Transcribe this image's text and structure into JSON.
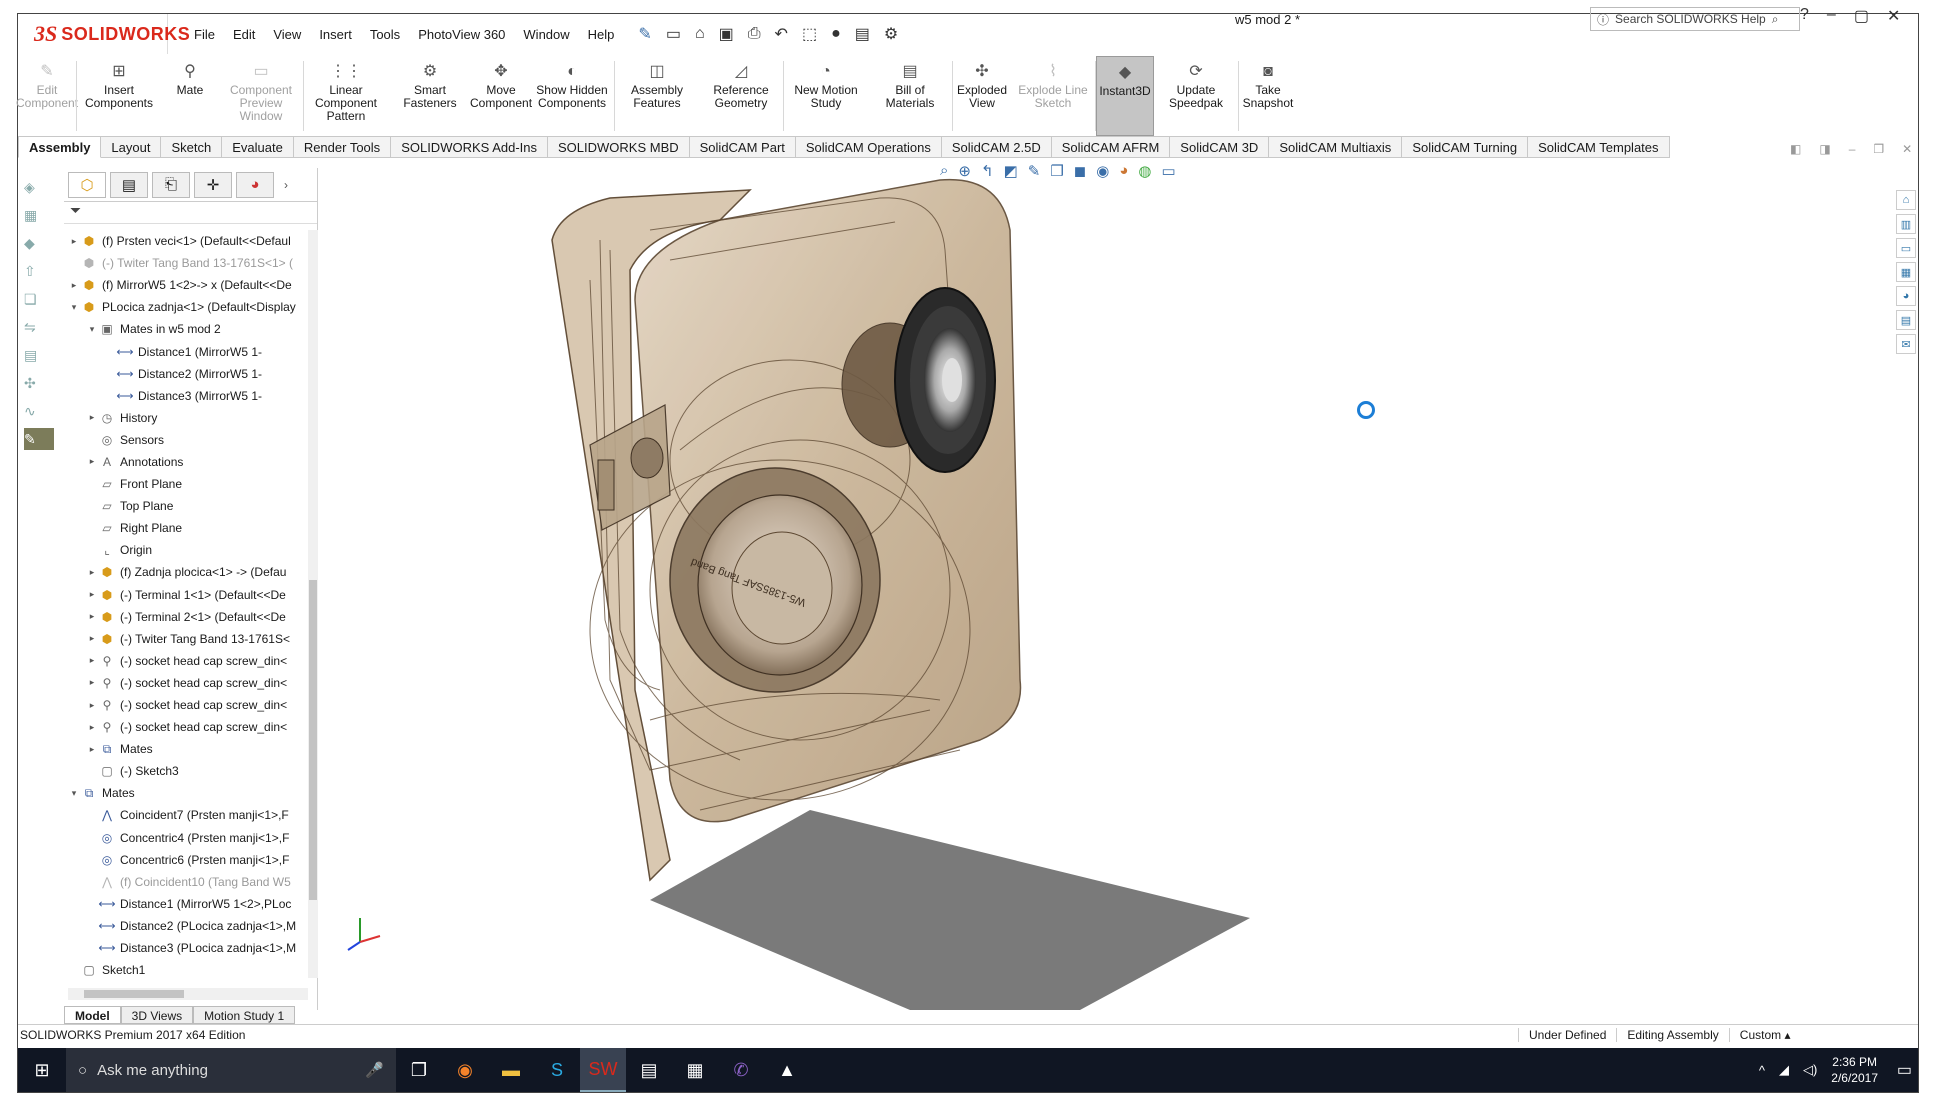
{
  "app": {
    "brand_mark": "3S",
    "brand_name": "SOLIDWORKS",
    "doc_title": "w5 mod 2 *"
  },
  "menu": [
    "File",
    "Edit",
    "View",
    "Insert",
    "Tools",
    "PhotoView 360",
    "Window",
    "Help"
  ],
  "search": {
    "placeholder": "Search SOLIDWORKS Help"
  },
  "commands": [
    {
      "label": "Edit Component",
      "icon": "edit-component-icon",
      "disabled": true
    },
    {
      "label": "Insert Components",
      "icon": "insert-components-icon",
      "disabled": false
    },
    {
      "label": "Mate",
      "icon": "mate-icon",
      "disabled": false
    },
    {
      "label": "Component Preview Window",
      "icon": "preview-window-icon",
      "disabled": true
    },
    {
      "label": "Linear Component Pattern",
      "icon": "linear-pattern-icon",
      "disabled": false
    },
    {
      "label": "Smart Fasteners",
      "icon": "smart-fasteners-icon",
      "disabled": false
    },
    {
      "label": "Move Component",
      "icon": "move-component-icon",
      "disabled": false
    },
    {
      "label": "Show Hidden Components",
      "icon": "show-hidden-icon",
      "disabled": false
    },
    {
      "label": "Assembly Features",
      "icon": "assembly-features-icon",
      "disabled": false
    },
    {
      "label": "Reference Geometry",
      "icon": "reference-geometry-icon",
      "disabled": false
    },
    {
      "label": "New Motion Study",
      "icon": "motion-study-icon",
      "disabled": false
    },
    {
      "label": "Bill of Materials",
      "icon": "bom-icon",
      "disabled": false
    },
    {
      "label": "Exploded View",
      "icon": "exploded-view-icon",
      "disabled": false
    },
    {
      "label": "Explode Line Sketch",
      "icon": "explode-line-icon",
      "disabled": true
    },
    {
      "label": "Instant3D",
      "icon": "instant3d-icon",
      "disabled": false,
      "active": true
    },
    {
      "label": "Update Speedpak",
      "icon": "speedpak-icon",
      "disabled": false
    },
    {
      "label": "Take Snapshot",
      "icon": "camera-icon",
      "disabled": false
    }
  ],
  "tabs": [
    "Assembly",
    "Layout",
    "Sketch",
    "Evaluate",
    "Render Tools",
    "SOLIDWORKS Add-Ins",
    "SOLIDWORKS MBD",
    "SolidCAM Part",
    "SolidCAM Operations",
    "SolidCAM 2.5D",
    "SolidCAM AFRM",
    "SolidCAM 3D",
    "SolidCAM Multiaxis",
    "SolidCAM Turning",
    "SolidCAM Templates"
  ],
  "tree": [
    {
      "label": "(f) Prsten veci<1> (Default<<Defaul",
      "level": 0,
      "exp": "▸",
      "icon": "part"
    },
    {
      "label": "(-) Twiter Tang Band 13-1761S<1> (",
      "level": 0,
      "exp": "",
      "icon": "suppr"
    },
    {
      "label": "(f) MirrorW5 1<2>-> x (Default<<De",
      "level": 0,
      "exp": "▸",
      "icon": "part"
    },
    {
      "label": "PLocica zadnja<1> (Default<Display",
      "level": 0,
      "exp": "▾",
      "icon": "part"
    },
    {
      "label": "Mates in w5 mod 2",
      "level": 1,
      "exp": "▾",
      "icon": "folder"
    },
    {
      "label": "Distance1 (MirrorW5 1-",
      "level": 2,
      "exp": "",
      "icon": "distance"
    },
    {
      "label": "Distance2 (MirrorW5 1-",
      "level": 2,
      "exp": "",
      "icon": "distance"
    },
    {
      "label": "Distance3 (MirrorW5 1-",
      "level": 2,
      "exp": "",
      "icon": "distance"
    },
    {
      "label": "History",
      "level": 1,
      "exp": "▸",
      "icon": "history"
    },
    {
      "label": "Sensors",
      "level": 1,
      "exp": "",
      "icon": "sensor"
    },
    {
      "label": "Annotations",
      "level": 1,
      "exp": "▸",
      "icon": "annotation"
    },
    {
      "label": "Front Plane",
      "level": 1,
      "exp": "",
      "icon": "plane"
    },
    {
      "label": "Top Plane",
      "level": 1,
      "exp": "",
      "icon": "plane"
    },
    {
      "label": "Right Plane",
      "level": 1,
      "exp": "",
      "icon": "plane"
    },
    {
      "label": "Origin",
      "level": 1,
      "exp": "",
      "icon": "origin"
    },
    {
      "label": "(f) Zadnja plocica<1> -> (Defau",
      "level": 1,
      "exp": "▸",
      "icon": "part"
    },
    {
      "label": "(-) Terminal 1<1> (Default<<De",
      "level": 1,
      "exp": "▸",
      "icon": "part"
    },
    {
      "label": "(-) Terminal 2<1> (Default<<De",
      "level": 1,
      "exp": "▸",
      "icon": "part"
    },
    {
      "label": "(-) Twiter Tang Band 13-1761S<",
      "level": 1,
      "exp": "▸",
      "icon": "part"
    },
    {
      "label": "(-) socket head cap screw_din<",
      "level": 1,
      "exp": "▸",
      "icon": "screw"
    },
    {
      "label": "(-) socket head cap screw_din<",
      "level": 1,
      "exp": "▸",
      "icon": "screw"
    },
    {
      "label": "(-) socket head cap screw_din<",
      "level": 1,
      "exp": "▸",
      "icon": "screw"
    },
    {
      "label": "(-) socket head cap screw_din<",
      "level": 1,
      "exp": "▸",
      "icon": "screw"
    },
    {
      "label": "Mates",
      "level": 1,
      "exp": "▸",
      "icon": "mates"
    },
    {
      "label": "(-) Sketch3",
      "level": 1,
      "exp": "",
      "icon": "sketch"
    },
    {
      "label": "Mates",
      "level": 0,
      "exp": "▾",
      "icon": "mates"
    },
    {
      "label": "Coincident7 (Prsten manji<1>,F",
      "level": 1,
      "exp": "",
      "icon": "coincident"
    },
    {
      "label": "Concentric4 (Prsten manji<1>,F",
      "level": 1,
      "exp": "",
      "icon": "concentric"
    },
    {
      "label": "Concentric6 (Prsten manji<1>,F",
      "level": 1,
      "exp": "",
      "icon": "concentric"
    },
    {
      "label": "(f) Coincident10 (Tang Band W5",
      "level": 1,
      "exp": "",
      "icon": "coincident-suppr"
    },
    {
      "label": "Distance1 (MirrorW5 1<2>,PLoc",
      "level": 1,
      "exp": "",
      "icon": "distance"
    },
    {
      "label": "Distance2 (PLocica zadnja<1>,M",
      "level": 1,
      "exp": "",
      "icon": "distance"
    },
    {
      "label": "Distance3 (PLocica zadnja<1>,M",
      "level": 1,
      "exp": "",
      "icon": "distance"
    },
    {
      "label": "Sketch1",
      "level": 0,
      "exp": "",
      "icon": "sketch"
    }
  ],
  "bottom_tabs": [
    "Model",
    "3D Views",
    "Motion Study 1"
  ],
  "status": {
    "left": "SOLIDWORKS Premium 2017 x64 Edition",
    "cells": [
      "Under Defined",
      "Editing Assembly",
      "Custom  ▴"
    ]
  },
  "taskbar": {
    "cortana": "Ask me anything",
    "time": "2:36 PM",
    "date": "2/6/2017"
  },
  "speaker_label": "W5-1385SAF Tang Band",
  "colors": {
    "accent": "#da291c",
    "wood_edge": "#5b4630",
    "wood_fill": "#c9b59a",
    "taskbar": "#101623"
  }
}
